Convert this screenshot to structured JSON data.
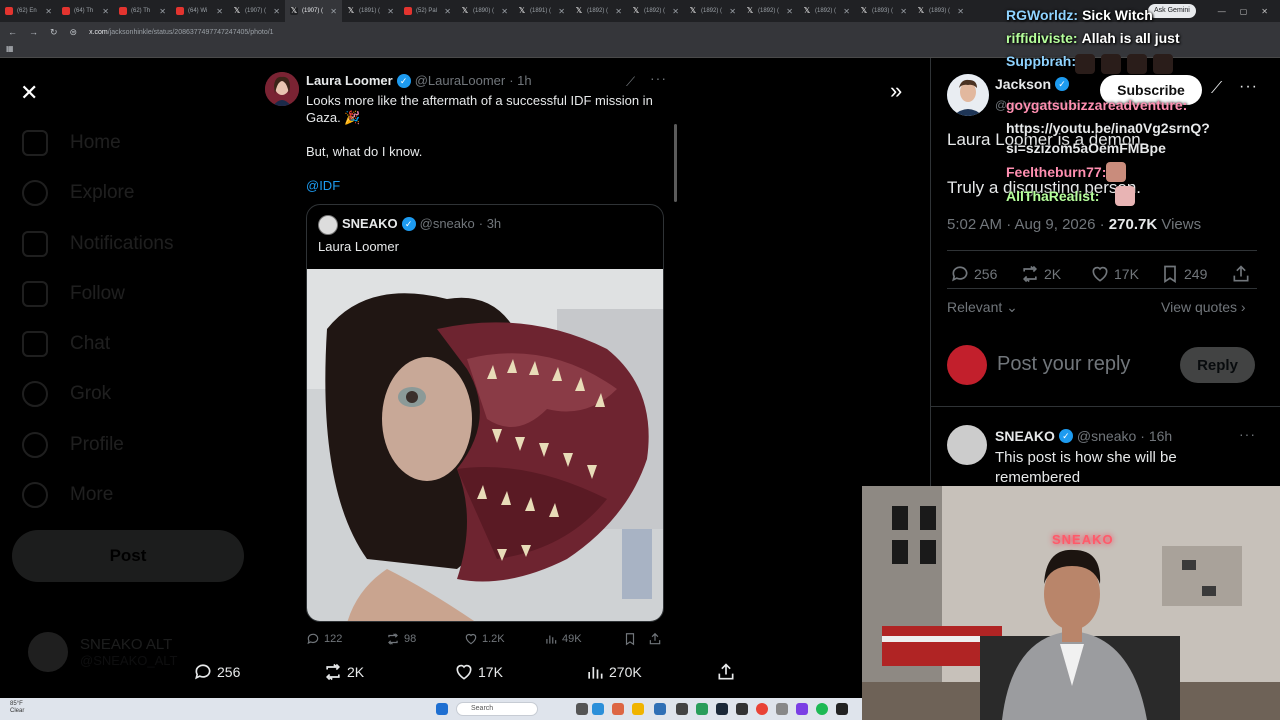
{
  "browser": {
    "tabs": [
      {
        "label": "(62) En",
        "icon": "youtube"
      },
      {
        "label": "(64) Th",
        "icon": "youtube"
      },
      {
        "label": "(62) Th",
        "icon": "youtube"
      },
      {
        "label": "(64) Wi",
        "icon": "youtube"
      },
      {
        "label": "(1907) (",
        "icon": "x"
      },
      {
        "label": "(1907) (",
        "icon": "x",
        "active": true
      },
      {
        "label": "(1891) (",
        "icon": "x"
      },
      {
        "label": "(52) Pal",
        "icon": "youtube"
      },
      {
        "label": "(1890) (",
        "icon": "x"
      },
      {
        "label": "(1891) (",
        "icon": "x"
      },
      {
        "label": "(1892) (",
        "icon": "x"
      },
      {
        "label": "(1892) (",
        "icon": "x"
      },
      {
        "label": "(1892) (",
        "icon": "x"
      },
      {
        "label": "(1892) (",
        "icon": "x"
      },
      {
        "label": "(1892) (",
        "icon": "x"
      },
      {
        "label": "(1893) (",
        "icon": "x"
      },
      {
        "label": "(1893) (",
        "icon": "x"
      }
    ],
    "url_host": "x.com",
    "url_path": "/jacksonhinkle/status/2086377497747247405/photo/1",
    "ask_gemini": "Ask Gemini"
  },
  "sidebar": {
    "items": [
      "Home",
      "Explore",
      "Notifications",
      "Follow",
      "Chat",
      "Grok",
      "Profile",
      "More"
    ],
    "post_button": "Post",
    "account_name": "SNEAKO ALT",
    "account_handle": "@SNEAKO_ALT"
  },
  "main_post": {
    "author": "Laura Loomer",
    "handle": "@LauraLoomer",
    "time": "· 1h",
    "line1": "Looks more like the aftermath of a successful IDF mission in Gaza. 🎉",
    "line2": "But, what do I know.",
    "mention": "@IDF",
    "quote": {
      "author": "SNEAKO",
      "handle": "@sneako",
      "time": "· 3h",
      "text": "Laura Loomer"
    },
    "actions": {
      "replies": "122",
      "reposts": "98",
      "likes": "1.2K",
      "views": "49K"
    }
  },
  "photo_actions": {
    "replies": "256",
    "reposts": "2K",
    "likes": "17K",
    "views": "270K"
  },
  "right_panel": {
    "author": "Jackson",
    "handle": "@jacksonhinkle",
    "line1": "Laura Loomer is a demon.",
    "line2": "Truly a disgusting person.",
    "timestamp": "5:02 AM · Aug 9, 2026",
    "views_count": "270.7K",
    "views_label": "Views",
    "actions": {
      "replies": "256",
      "reposts": "2K",
      "likes": "17K",
      "bookmarks": "249"
    },
    "relevant_label": "Relevant",
    "view_quotes": "View quotes",
    "reply_placeholder": "Post your reply",
    "reply_button": "Reply",
    "reply_post": {
      "author": "SNEAKO",
      "handle": "@sneako",
      "time": "· 16h",
      "text": "This post is how she will be remembered"
    }
  },
  "chat": {
    "messages": [
      {
        "user": "RGWorldz:",
        "text": "Sick Witch",
        "color": "#8fd3ff"
      },
      {
        "user": "riffidiviste:",
        "text": "Allah is all just",
        "color": "#b6ff9c"
      },
      {
        "user": "Suppbrah:",
        "text": "",
        "color": "#8fd3ff"
      },
      {
        "user": "goygatsubizzareadventure:",
        "text": "https://youtu.be/ina0Vg2srnQ?si=szizom5aOemFMBpe",
        "color": "#ff8fb1"
      },
      {
        "user": "Feeltheburn77:",
        "text": "",
        "color": "#ff8fb1"
      },
      {
        "user": "AllThaRealist:",
        "text": "",
        "color": "#b6ff9c"
      }
    ],
    "subscribe_label": "Subscribe"
  },
  "webcam": {
    "neon_sign": "SNEAKO"
  },
  "taskbar": {
    "temperature": "85°F",
    "condition": "Clear",
    "search_placeholder": "Search"
  },
  "colors": {
    "accent": "#1d9bf0",
    "background": "#000000",
    "text": "#e7e9ea",
    "muted": "#71767b"
  }
}
